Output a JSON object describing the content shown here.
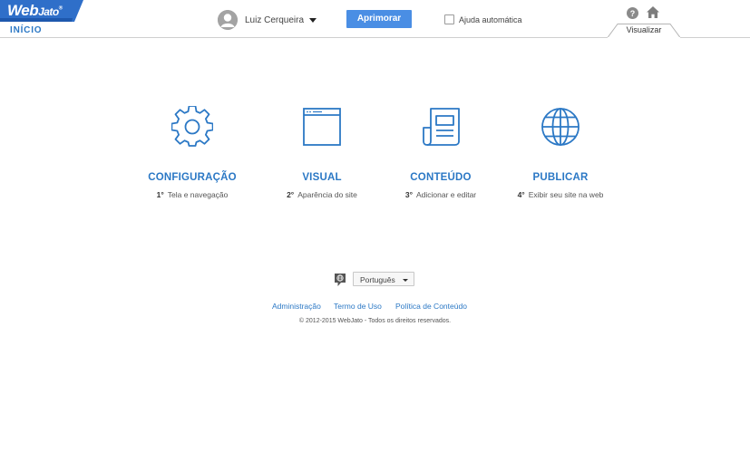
{
  "header": {
    "logo": {
      "text": "Web",
      "text_small": "Jato",
      "trademark": "®"
    },
    "inicio_label": "INÍCIO",
    "user_name": "Luiz Cerqueira",
    "aprimorar_label": "Aprimorar",
    "ajuda_label": "Ajuda automática",
    "ajuda_checked": false,
    "help_icon": "question-circle-icon",
    "home_icon": "home-icon",
    "tab_label": "Visualizar"
  },
  "steps": [
    {
      "icon": "gear-icon",
      "title": "CONFIGURAÇÃO",
      "number": "1°",
      "description": "Tela e navegação"
    },
    {
      "icon": "browser-window-icon",
      "title": "VISUAL",
      "number": "2°",
      "description": "Aparência do site"
    },
    {
      "icon": "newspaper-icon",
      "title": "CONTEÚDO",
      "number": "3°",
      "description": "Adicionar e editar"
    },
    {
      "icon": "globe-icon",
      "title": "PUBLICAR",
      "number": "4°",
      "description": "Exibir seu site na web"
    }
  ],
  "footer": {
    "language_icon": "speech-globe-icon",
    "language_selected": "Português",
    "links": [
      "Administração",
      "Termo de Uso",
      "Política de Conteúdo"
    ],
    "copyright": "© 2012-2015 WebJato - Todos os direitos reservados."
  },
  "colors": {
    "accent": "#2b78c5",
    "button": "#4a8ee4",
    "logo": "#2f6fc9"
  }
}
